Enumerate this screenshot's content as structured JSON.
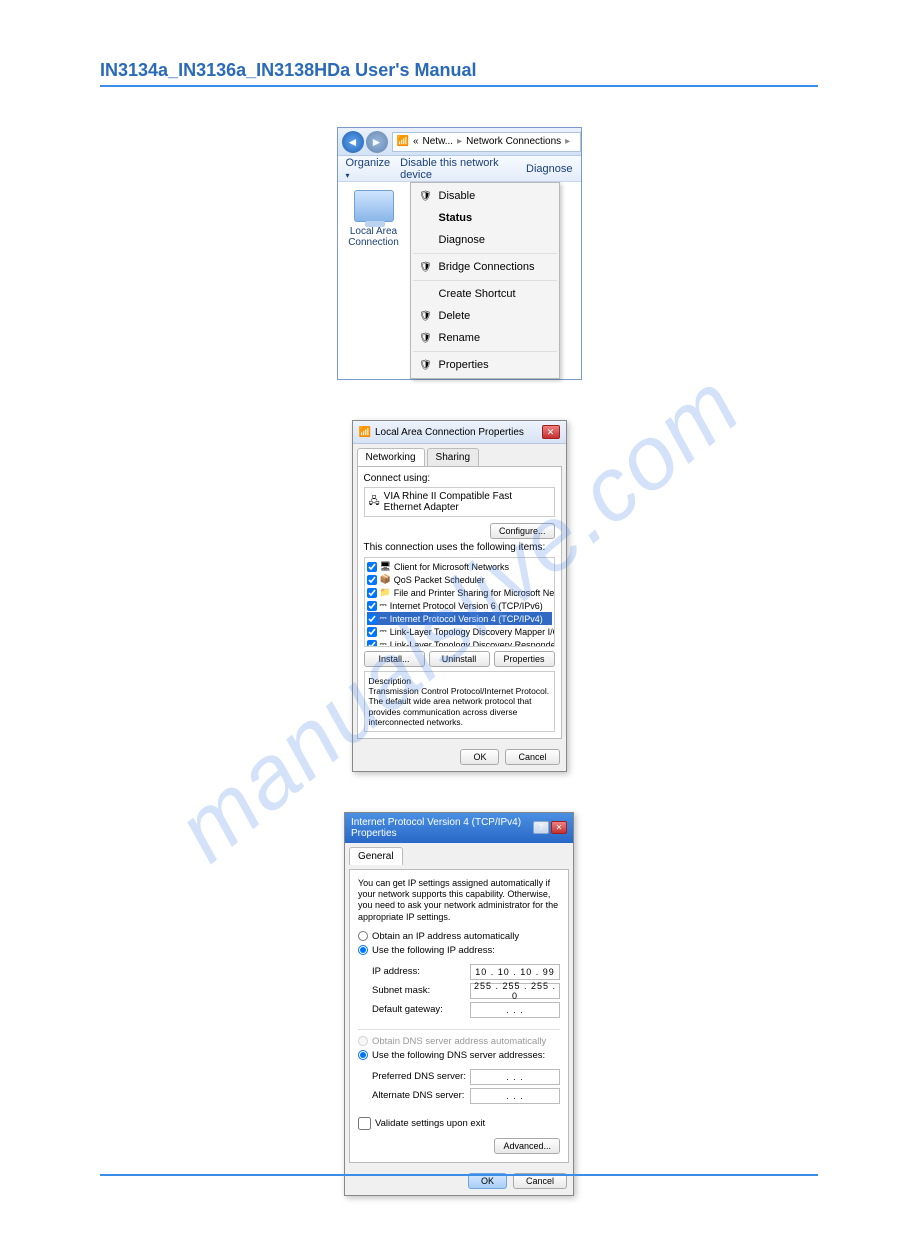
{
  "header": {
    "title": "IN3134a_IN3136a_IN3138HDa User's Manual"
  },
  "watermark": "manualslive.com",
  "ss1": {
    "breadcrumb_prefix": "«",
    "breadcrumb_item1": "Netw...",
    "breadcrumb_item2": "Network Connections",
    "toolbar_organize": "Organize",
    "toolbar_disable": "Disable this network device",
    "toolbar_diagnose": "Diagnose",
    "lac_label_line1": "Local Area",
    "lac_label_line2": "Connection",
    "ctx": {
      "disable": "Disable",
      "status": "Status",
      "diagnose": "Diagnose",
      "bridge": "Bridge Connections",
      "shortcut": "Create Shortcut",
      "delete": "Delete",
      "rename": "Rename",
      "properties": "Properties"
    }
  },
  "ss2": {
    "title": "Local Area Connection Properties",
    "tab_networking": "Networking",
    "tab_sharing": "Sharing",
    "connect_using": "Connect using:",
    "adapter": "VIA Rhine II Compatible Fast Ethernet Adapter",
    "configure": "Configure...",
    "uses_items": "This connection uses the following items:",
    "items": [
      "Client for Microsoft Networks",
      "QoS Packet Scheduler",
      "File and Printer Sharing for Microsoft Networks",
      "Internet Protocol Version 6 (TCP/IPv6)",
      "Internet Protocol Version 4 (TCP/IPv4)",
      "Link-Layer Topology Discovery Mapper I/O Driver",
      "Link-Layer Topology Discovery Responder"
    ],
    "btn_install": "Install...",
    "btn_uninstall": "Uninstall",
    "btn_properties": "Properties",
    "desc_label": "Description",
    "desc_text": "Transmission Control Protocol/Internet Protocol. The default wide area network protocol that provides communication across diverse interconnected networks.",
    "ok": "OK",
    "cancel": "Cancel"
  },
  "ss3": {
    "title": "Internet Protocol Version 4 (TCP/IPv4) Properties",
    "tab_general": "General",
    "intro": "You can get IP settings assigned automatically if your network supports this capability. Otherwise, you need to ask your network administrator for the appropriate IP settings.",
    "radio_auto_ip": "Obtain an IP address automatically",
    "radio_use_ip": "Use the following IP address:",
    "ip_label": "IP address:",
    "ip_value": "10 . 10 . 10 . 99",
    "subnet_label": "Subnet mask:",
    "subnet_value": "255 . 255 . 255 .  0",
    "gateway_label": "Default gateway:",
    "gateway_value": ".      .      .",
    "radio_auto_dns": "Obtain DNS server address automatically",
    "radio_use_dns": "Use the following DNS server addresses:",
    "pref_dns_label": "Preferred DNS server:",
    "pref_dns_value": ".      .      .",
    "alt_dns_label": "Alternate DNS server:",
    "alt_dns_value": ".      .      .",
    "validate": "Validate settings upon exit",
    "advanced": "Advanced...",
    "ok": "OK",
    "cancel": "Cancel"
  }
}
